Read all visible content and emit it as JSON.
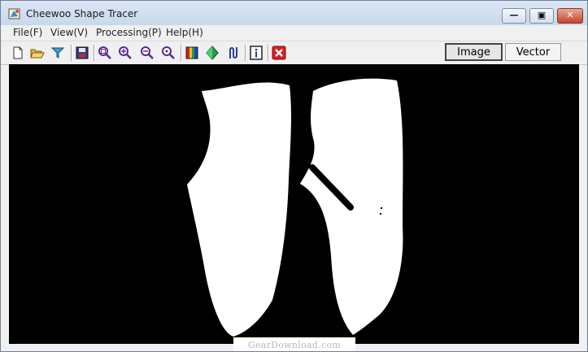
{
  "window": {
    "title": "Cheewoo Shape Tracer"
  },
  "menu": {
    "items": [
      "File(F)",
      "View(V)",
      "Processing(P)",
      "Help(H)"
    ]
  },
  "toolbar": {
    "icons": [
      "new-icon",
      "open-icon",
      "filter-icon",
      "save-icon",
      "zoom-fit-icon",
      "zoom-in-icon",
      "zoom-out-icon",
      "zoom-actual-icon",
      "color-icon",
      "flip-icon",
      "rotate-icon",
      "info-icon",
      "close-icon"
    ]
  },
  "view_tabs": {
    "image": "Image",
    "vector": "Vector",
    "active": "Image"
  },
  "watermark": "GearDownload.com",
  "colors": {
    "titlebar": "#c8d8ec",
    "canvas": "#000000",
    "shape": "#ffffff",
    "close_button": "#c4442b"
  }
}
